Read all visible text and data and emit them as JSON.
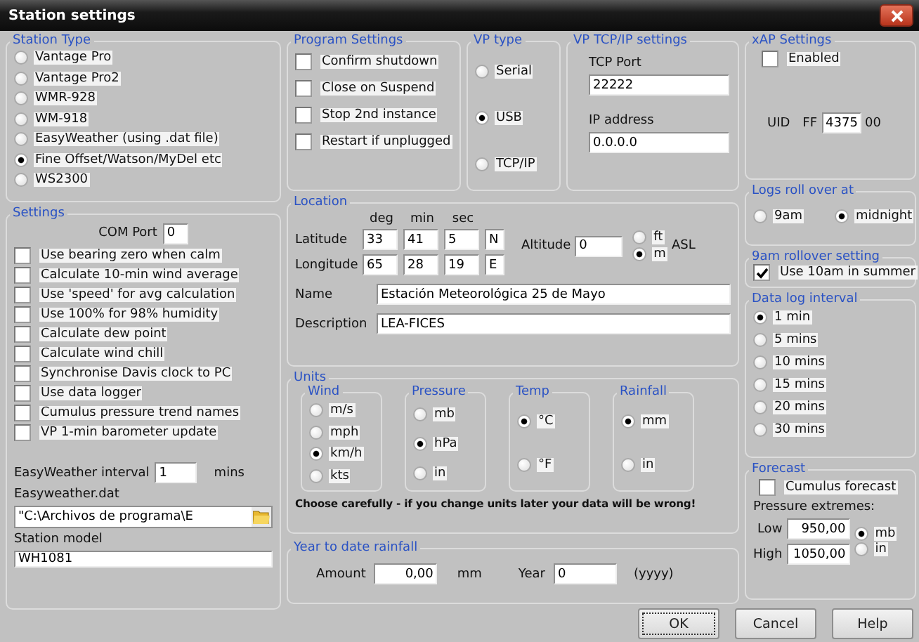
{
  "window": {
    "title": "Station settings"
  },
  "station_type": {
    "title": "Station Type",
    "options": [
      {
        "label": "Vantage Pro",
        "selected": false
      },
      {
        "label": "Vantage Pro2",
        "selected": false
      },
      {
        "label": "WMR-928",
        "selected": false
      },
      {
        "label": "WM-918",
        "selected": false
      },
      {
        "label": "EasyWeather (using .dat file)",
        "selected": false
      },
      {
        "label": "Fine Offset/Watson/MyDel etc",
        "selected": true
      },
      {
        "label": "WS2300",
        "selected": false
      }
    ]
  },
  "settings": {
    "title": "Settings",
    "com_port_label": "COM Port",
    "com_port": "0",
    "checks": [
      {
        "label": "Use bearing zero when calm",
        "checked": false
      },
      {
        "label": "Calculate 10-min wind average",
        "checked": false
      },
      {
        "label": "Use 'speed' for avg calculation",
        "checked": false
      },
      {
        "label": "Use 100% for 98% humidity",
        "checked": false
      },
      {
        "label": "Calculate dew point",
        "checked": false
      },
      {
        "label": "Calculate wind chill",
        "checked": false
      },
      {
        "label": "Synchronise Davis clock to PC",
        "checked": false
      },
      {
        "label": "Use data logger",
        "checked": false
      },
      {
        "label": "Cumulus pressure trend names",
        "checked": false
      },
      {
        "label": "VP 1-min barometer update",
        "checked": false
      }
    ],
    "interval_label": "EasyWeather interval",
    "interval": "1",
    "interval_unit": "mins",
    "file_label": "Easyweather.dat",
    "file": "\"C:\\Archivos de programa\\E",
    "model_label": "Station model",
    "model": "WH1081"
  },
  "program_settings": {
    "title": "Program Settings",
    "checks": [
      {
        "label": "Confirm shutdown",
        "checked": false
      },
      {
        "label": "Close on Suspend",
        "checked": false
      },
      {
        "label": "Stop 2nd instance",
        "checked": false
      },
      {
        "label": "Restart if unplugged",
        "checked": false
      }
    ]
  },
  "vp_type": {
    "title": "VP type",
    "options": [
      {
        "label": "Serial",
        "selected": false
      },
      {
        "label": "USB",
        "selected": true
      },
      {
        "label": "TCP/IP",
        "selected": false
      }
    ]
  },
  "tcpip": {
    "title": "VP TCP/IP settings",
    "port_label": "TCP Port",
    "port": "22222",
    "ip_label": "IP address",
    "ip": "0.0.0.0"
  },
  "xap": {
    "title": "xAP Settings",
    "enabled": {
      "label": "Enabled",
      "checked": false
    },
    "uid_label": "UID",
    "uid_prefix": "FF",
    "uid": "4375",
    "uid_suffix": "00"
  },
  "location": {
    "title": "Location",
    "headers": [
      "deg",
      "min",
      "sec"
    ],
    "rows": [
      {
        "label": "Latitude",
        "values": [
          "33",
          "41",
          "5",
          "N"
        ]
      },
      {
        "label": "Longitude",
        "values": [
          "65",
          "28",
          "19",
          "E"
        ]
      }
    ],
    "altitude_label": "Altitude",
    "altitude": "0",
    "altitude_units": [
      {
        "label": "ft",
        "selected": false
      },
      {
        "label": "m",
        "selected": true
      }
    ],
    "asl": "ASL",
    "name_label": "Name",
    "name": "Estación Meteorológica 25 de Mayo",
    "description_label": "Description",
    "description": "LEA-FICES"
  },
  "units": {
    "title": "Units",
    "groups": [
      {
        "title": "Wind",
        "options": [
          {
            "label": "m/s",
            "selected": false
          },
          {
            "label": "mph",
            "selected": false
          },
          {
            "label": "km/h",
            "selected": true
          },
          {
            "label": "kts",
            "selected": false
          }
        ]
      },
      {
        "title": "Pressure",
        "options": [
          {
            "label": "mb",
            "selected": false
          },
          {
            "label": "hPa",
            "selected": true
          },
          {
            "label": "in",
            "selected": false
          }
        ]
      },
      {
        "title": "Temp",
        "options": [
          {
            "label": "°C",
            "selected": true
          },
          {
            "label": "°F",
            "selected": false
          }
        ]
      },
      {
        "title": "Rainfall",
        "options": [
          {
            "label": "mm",
            "selected": true
          },
          {
            "label": "in",
            "selected": false
          }
        ]
      }
    ],
    "warning": "Choose carefully - if you change units later your data will be wrong!"
  },
  "ytd_rainfall": {
    "title": "Year to date rainfall",
    "amount_label": "Amount",
    "amount": "0,00",
    "amount_unit": "mm",
    "year_label": "Year",
    "year": "0",
    "year_hint": "(yyyy)"
  },
  "logs_rollover": {
    "title": "Logs roll over at",
    "options": [
      {
        "label": "9am",
        "selected": false
      },
      {
        "label": "midnight",
        "selected": true
      }
    ]
  },
  "rollover_setting": {
    "title": "9am rollover setting",
    "check": {
      "label": "Use 10am in summer",
      "checked": true
    }
  },
  "log_interval": {
    "title": "Data log interval",
    "options": [
      {
        "label": "1 min",
        "selected": true
      },
      {
        "label": "5 mins",
        "selected": false
      },
      {
        "label": "10 mins",
        "selected": false
      },
      {
        "label": "15 mins",
        "selected": false
      },
      {
        "label": "20 mins",
        "selected": false
      },
      {
        "label": "30 mins",
        "selected": false
      }
    ]
  },
  "forecast": {
    "title": "Forecast",
    "check": {
      "label": "Cumulus forecast",
      "checked": false
    },
    "extremes_label": "Pressure extremes:",
    "low_label": "Low",
    "low": "950,00",
    "high_label": "High",
    "high": "1050,00",
    "units": [
      {
        "label": "mb",
        "selected": true
      },
      {
        "label": "in",
        "selected": false
      }
    ]
  },
  "buttons": [
    {
      "label": "OK",
      "focused": true
    },
    {
      "label": "Cancel",
      "focused": false
    },
    {
      "label": "Help",
      "focused": false
    }
  ]
}
